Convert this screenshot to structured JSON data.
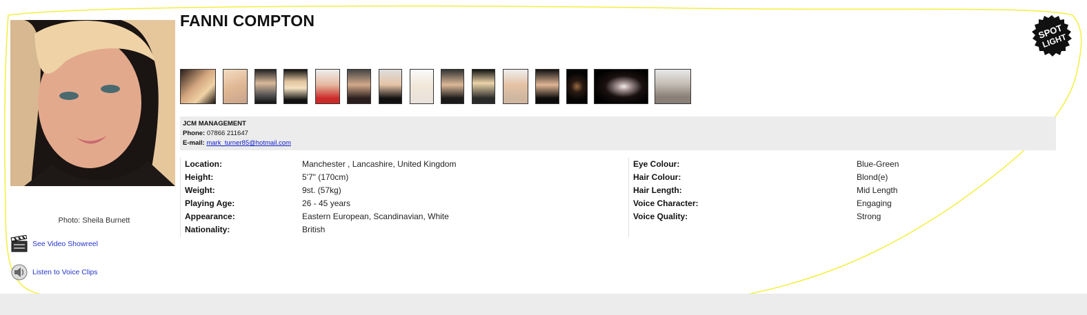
{
  "profile": {
    "name": "FANNI COMPTON",
    "photo_credit": "Photo: Sheila Burnett"
  },
  "links": {
    "video_label": "See Video Showreel",
    "voice_label": "Listen to Voice Clips"
  },
  "logo": {
    "text": "SPOTLIGHT"
  },
  "contact": {
    "agency": "JCM MANAGEMENT",
    "phone_label": "Phone:",
    "phone_value": "07866 211647",
    "email_label": "E-mail:",
    "email_value": "mark_turner85@hotmail.com"
  },
  "details_left": [
    {
      "label": "Location:",
      "value": "Manchester , Lancashire, United Kingdom"
    },
    {
      "label": "Height:",
      "value": "5'7\" (170cm)"
    },
    {
      "label": "Weight:",
      "value": "9st. (57kg)"
    },
    {
      "label": "Playing Age:",
      "value": "26 - 45 years"
    },
    {
      "label": "Appearance:",
      "value": "Eastern European, Scandinavian, White"
    },
    {
      "label": "Nationality:",
      "value": "British"
    }
  ],
  "details_right": [
    {
      "label": "Eye Colour:",
      "value": "Blue-Green"
    },
    {
      "label": "Hair Colour:",
      "value": "Blond(e)"
    },
    {
      "label": "Hair Length:",
      "value": "Mid Length"
    },
    {
      "label": "Voice Character:",
      "value": "Engaging"
    },
    {
      "label": "Voice Quality:",
      "value": "Strong"
    }
  ],
  "colors": {
    "link": "#2233cc",
    "panel_bg": "#ececec",
    "outline": "#f5f542"
  }
}
